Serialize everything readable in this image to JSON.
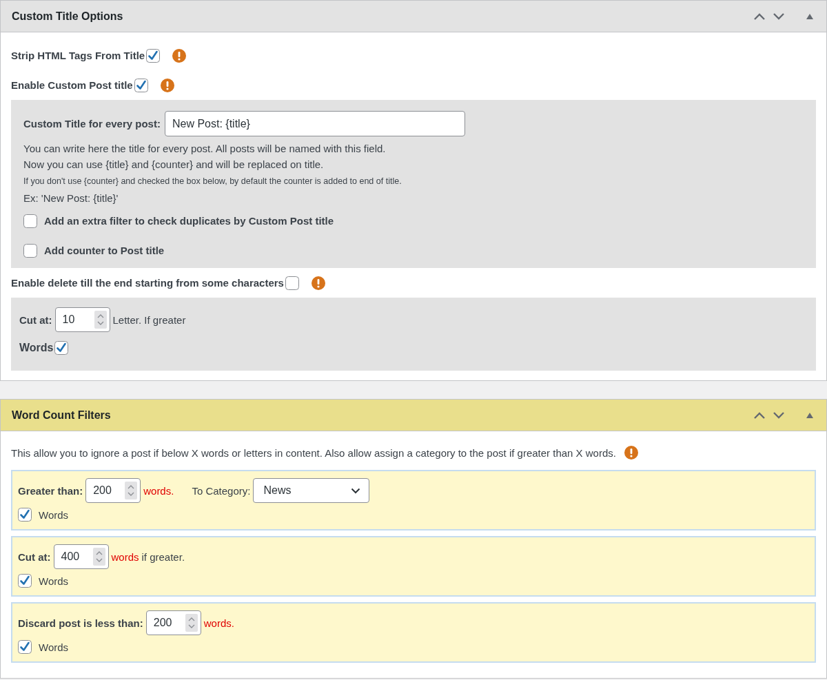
{
  "panels": [
    {
      "title": "Custom Title Options",
      "highlighted": false,
      "items": [
        {
          "kind": "check",
          "label": "Strip HTML Tags From Title",
          "checked": true,
          "warning": true
        },
        {
          "kind": "check",
          "label": "Enable Custom Post title",
          "checked": true,
          "warning": true
        },
        {
          "kind": "group",
          "items": [
            {
              "kind": "field",
              "label": "Custom Title for every post:",
              "value": "New Post: {title}"
            },
            {
              "kind": "note",
              "text": "You can write here the title for every post. All posts will be named with this field.",
              "small": false
            },
            {
              "kind": "note",
              "text": "Now you can use {title} and {counter} and will be replaced on title.",
              "small": false
            },
            {
              "kind": "note",
              "text": "If you don't use {counter} and checked the box below, by default the counter is added to end of title.",
              "small": true
            },
            {
              "kind": "note",
              "text": "Ex: 'New Post: {title}'",
              "small": false
            },
            {
              "kind": "box-check",
              "label": "Add an extra filter to check duplicates by Custom Post title",
              "checked": false
            },
            {
              "kind": "box-check",
              "label": "Add counter to Post title",
              "checked": false
            }
          ]
        },
        {
          "kind": "check",
          "label": "Enable delete till the end starting from some characters",
          "checked": false,
          "warning": true
        },
        {
          "kind": "group",
          "items": [
            {
              "kind": "number",
              "label": "Cut at:",
              "value": "10",
              "suffix": [
                {
                  "text": "Letter. If greater",
                  "alert": false
                }
              ]
            },
            {
              "kind": "check",
              "label": "Words",
              "checked": true,
              "warning": false
            }
          ]
        }
      ]
    },
    {
      "title": "Word Count Filters",
      "highlighted": true,
      "items": [
        {
          "kind": "intro",
          "text": "This allow you to ignore a post if below X words or letters in content. Also allow assign a category to the post if greater than X words.",
          "warning": true
        },
        {
          "kind": "filter",
          "label": "Greater than:",
          "value": "200",
          "suffix": [
            {
              "text": "words.",
              "alert": true
            }
          ],
          "category_label": "To Category:",
          "category": "News",
          "check_label": "Words",
          "checked": true
        },
        {
          "kind": "filter",
          "label": "Cut at:",
          "value": "400",
          "suffix": [
            {
              "text": "words",
              "alert": true
            },
            {
              "text": "if greater.",
              "alert": false
            }
          ],
          "check_label": "Words",
          "checked": true
        },
        {
          "kind": "filter",
          "label": "Discard post is less than:",
          "value": "200",
          "suffix": [
            {
              "text": "words.",
              "alert": true
            }
          ],
          "check_label": "Words",
          "checked": true
        }
      ]
    }
  ]
}
